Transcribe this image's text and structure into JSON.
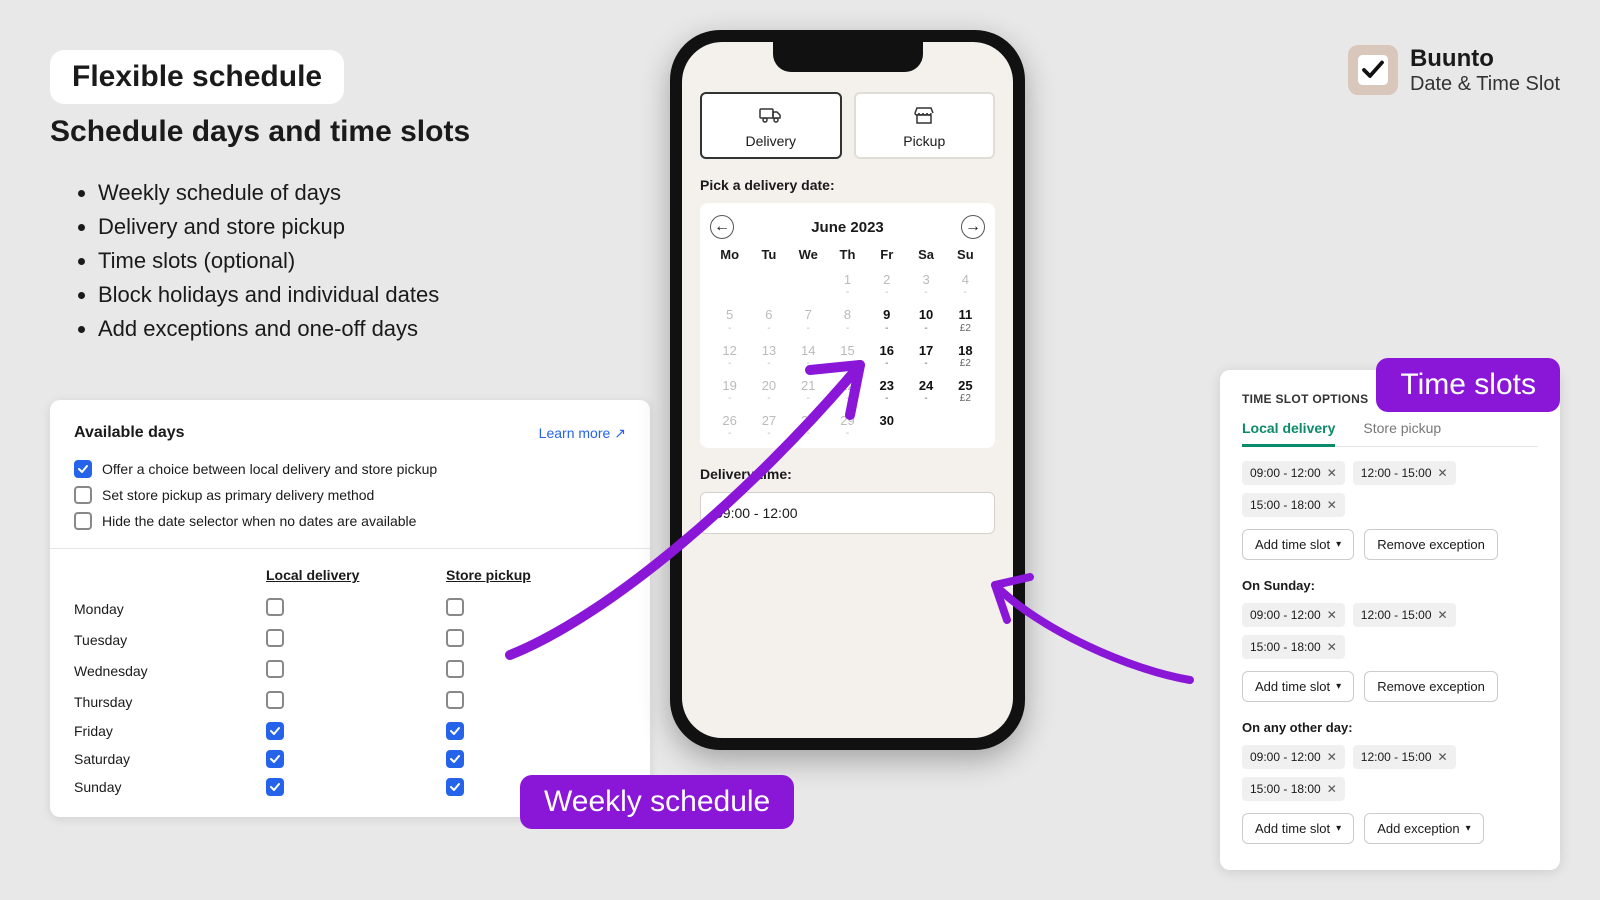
{
  "hero": {
    "badge": "Flexible schedule",
    "subtitle": "Schedule days and time slots",
    "bullets": [
      "Weekly schedule of days",
      "Delivery and store pickup",
      "Time slots (optional)",
      "Block holidays and individual dates",
      "Add exceptions and one-off days"
    ]
  },
  "brand": {
    "title": "Buunto",
    "subtitle": "Date & Time Slot"
  },
  "pills": {
    "weekly": "Weekly schedule",
    "timeslots": "Time slots"
  },
  "daysCard": {
    "title": "Available days",
    "learnMore": "Learn more",
    "options": [
      {
        "label": "Offer a choice between local delivery and store pickup",
        "checked": true
      },
      {
        "label": "Set store pickup as primary delivery method",
        "checked": false
      },
      {
        "label": "Hide the date selector when no dates are available",
        "checked": false
      }
    ],
    "columns": {
      "a": "Local delivery",
      "b": "Store pickup"
    },
    "rows": [
      {
        "day": "Monday",
        "a": false,
        "b": false
      },
      {
        "day": "Tuesday",
        "a": false,
        "b": false
      },
      {
        "day": "Wednesday",
        "a": false,
        "b": false
      },
      {
        "day": "Thursday",
        "a": false,
        "b": false
      },
      {
        "day": "Friday",
        "a": true,
        "b": true
      },
      {
        "day": "Saturday",
        "a": true,
        "b": true
      },
      {
        "day": "Sunday",
        "a": true,
        "b": true
      }
    ]
  },
  "phone": {
    "tabs": {
      "delivery": "Delivery",
      "pickup": "Pickup"
    },
    "pickLabel": "Pick a delivery date:",
    "monthTitle": "June 2023",
    "dow": [
      "Mo",
      "Tu",
      "We",
      "Th",
      "Fr",
      "Sa",
      "Su"
    ],
    "cells": [
      {
        "n": "",
        "sub": ""
      },
      {
        "n": "",
        "sub": ""
      },
      {
        "n": "",
        "sub": ""
      },
      {
        "n": "1",
        "sub": "-"
      },
      {
        "n": "2",
        "sub": "-"
      },
      {
        "n": "3",
        "sub": "-"
      },
      {
        "n": "4",
        "sub": "-"
      },
      {
        "n": "5",
        "sub": "-"
      },
      {
        "n": "6",
        "sub": "-"
      },
      {
        "n": "7",
        "sub": "-"
      },
      {
        "n": "8",
        "sub": "-"
      },
      {
        "n": "9",
        "sub": "-",
        "avail": true
      },
      {
        "n": "10",
        "sub": "-",
        "avail": true
      },
      {
        "n": "11",
        "sub": "£2",
        "avail": true
      },
      {
        "n": "12",
        "sub": "-"
      },
      {
        "n": "13",
        "sub": "-"
      },
      {
        "n": "14",
        "sub": "-"
      },
      {
        "n": "15",
        "sub": "-"
      },
      {
        "n": "16",
        "sub": "-",
        "avail": true
      },
      {
        "n": "17",
        "sub": "-",
        "avail": true
      },
      {
        "n": "18",
        "sub": "£2",
        "avail": true
      },
      {
        "n": "19",
        "sub": "-"
      },
      {
        "n": "20",
        "sub": "-"
      },
      {
        "n": "21",
        "sub": "-"
      },
      {
        "n": "22",
        "sub": "-"
      },
      {
        "n": "23",
        "sub": "-",
        "avail": true
      },
      {
        "n": "24",
        "sub": "-",
        "avail": true
      },
      {
        "n": "25",
        "sub": "£2",
        "avail": true
      },
      {
        "n": "26",
        "sub": "-"
      },
      {
        "n": "27",
        "sub": "-"
      },
      {
        "n": "28",
        "sub": "-"
      },
      {
        "n": "29",
        "sub": "-"
      },
      {
        "n": "30",
        "sub": "",
        "avail": true
      },
      {
        "n": "",
        "sub": ""
      },
      {
        "n": "",
        "sub": ""
      }
    ],
    "timeLabel": "Delivery time:",
    "timeValue": "09:00 - 12:00"
  },
  "slots": {
    "heading": "TIME SLOT OPTIONS",
    "tabs": {
      "local": "Local delivery",
      "pickup": "Store pickup"
    },
    "chipSet": [
      "09:00 - 12:00",
      "12:00 - 15:00",
      "15:00 - 18:00"
    ],
    "btnAdd": "Add time slot",
    "btnRemove": "Remove exception",
    "btnAddException": "Add exception",
    "groupSunday": "On Sunday:",
    "groupOther": "On any other day:"
  }
}
